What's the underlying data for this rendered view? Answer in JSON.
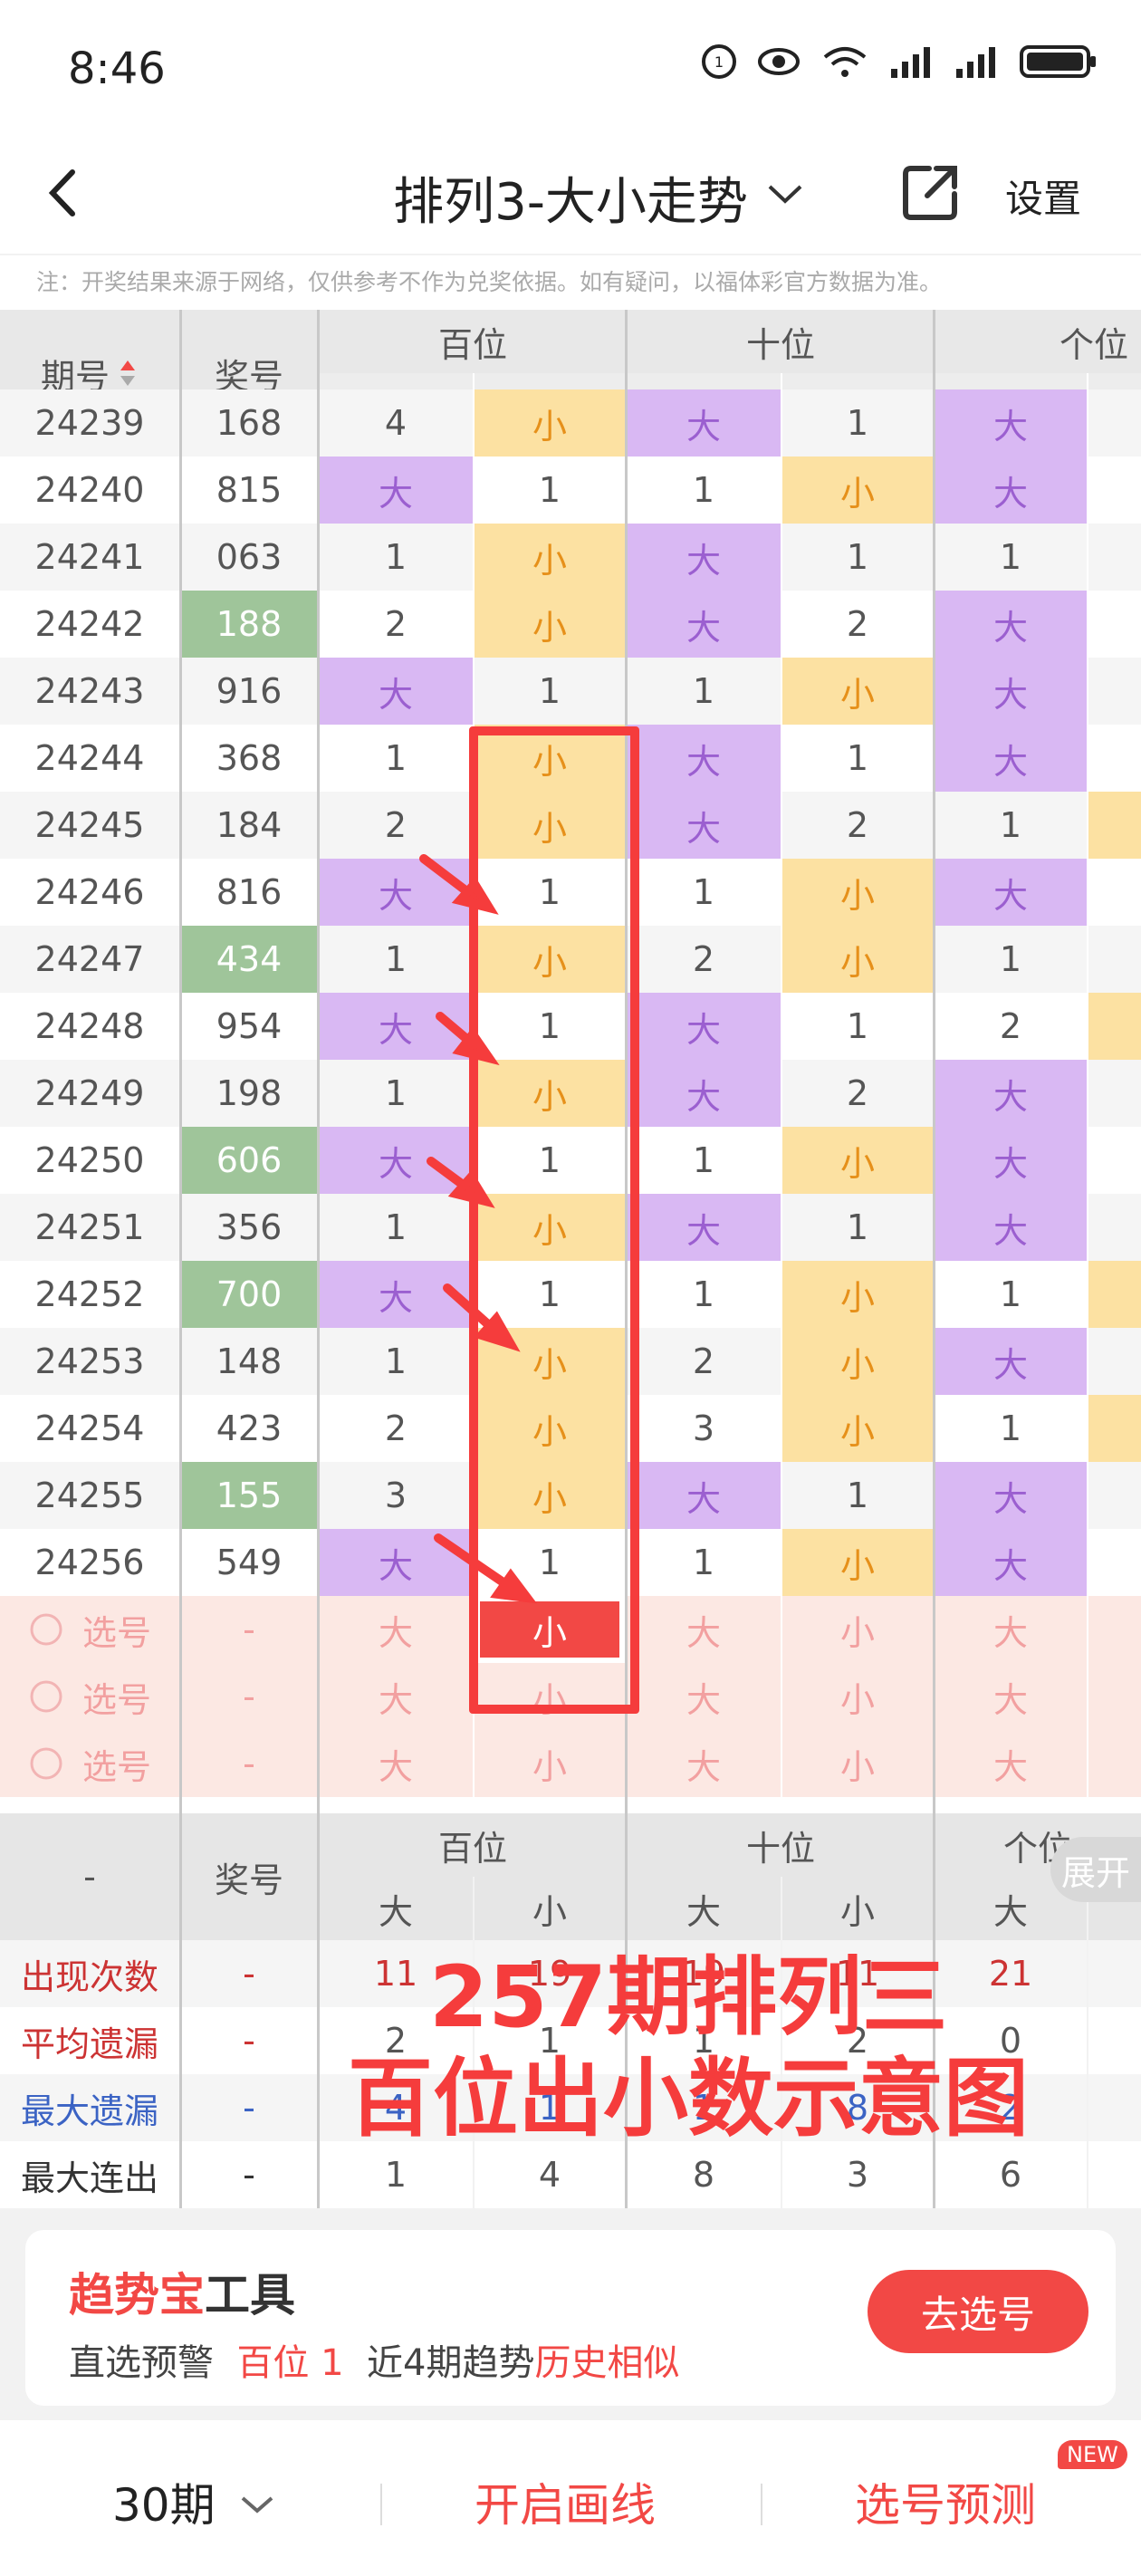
{
  "status": {
    "time": "8:46"
  },
  "header": {
    "title": "排列3-大小走势",
    "settings": "设置"
  },
  "notice": "注：开奖结果来源于网络，仅供参考不作为兑奖依据。如有疑问，以福体彩官方数据为准。",
  "table": {
    "col_issue": "期号",
    "col_number": "奖号",
    "group_hundreds": "百位",
    "group_tens": "十位",
    "group_units": "个位",
    "sub_big": "大",
    "sub_small": "小"
  },
  "rows": [
    {
      "issue": "24239",
      "num": "168",
      "hb": "4",
      "hs": "小",
      "tb": "大",
      "ts": "1",
      "ub": "大",
      "green": false
    },
    {
      "issue": "24240",
      "num": "815",
      "hb": "大",
      "hs": "1",
      "tb": "1",
      "ts": "小",
      "ub": "大",
      "green": false
    },
    {
      "issue": "24241",
      "num": "063",
      "hb": "1",
      "hs": "小",
      "tb": "大",
      "ts": "1",
      "ub": "1",
      "green": false
    },
    {
      "issue": "24242",
      "num": "188",
      "hb": "2",
      "hs": "小",
      "tb": "大",
      "ts": "2",
      "ub": "大",
      "green": true
    },
    {
      "issue": "24243",
      "num": "916",
      "hb": "大",
      "hs": "1",
      "tb": "1",
      "ts": "小",
      "ub": "大",
      "green": false
    },
    {
      "issue": "24244",
      "num": "368",
      "hb": "1",
      "hs": "小",
      "tb": "大",
      "ts": "1",
      "ub": "大",
      "green": false
    },
    {
      "issue": "24245",
      "num": "184",
      "hb": "2",
      "hs": "小",
      "tb": "大",
      "ts": "2",
      "ub": "1",
      "green": false
    },
    {
      "issue": "24246",
      "num": "816",
      "hb": "大",
      "hs": "1",
      "tb": "1",
      "ts": "小",
      "ub": "大",
      "green": false
    },
    {
      "issue": "24247",
      "num": "434",
      "hb": "1",
      "hs": "小",
      "tb": "2",
      "ts": "小",
      "ub": "1",
      "green": true
    },
    {
      "issue": "24248",
      "num": "954",
      "hb": "大",
      "hs": "1",
      "tb": "大",
      "ts": "1",
      "ub": "2",
      "green": false
    },
    {
      "issue": "24249",
      "num": "198",
      "hb": "1",
      "hs": "小",
      "tb": "大",
      "ts": "2",
      "ub": "大",
      "green": false
    },
    {
      "issue": "24250",
      "num": "606",
      "hb": "大",
      "hs": "1",
      "tb": "1",
      "ts": "小",
      "ub": "大",
      "green": true
    },
    {
      "issue": "24251",
      "num": "356",
      "hb": "1",
      "hs": "小",
      "tb": "大",
      "ts": "1",
      "ub": "大",
      "green": false
    },
    {
      "issue": "24252",
      "num": "700",
      "hb": "大",
      "hs": "1",
      "tb": "1",
      "ts": "小",
      "ub": "1",
      "green": true
    },
    {
      "issue": "24253",
      "num": "148",
      "hb": "1",
      "hs": "小",
      "tb": "2",
      "ts": "小",
      "ub": "大",
      "green": false
    },
    {
      "issue": "24254",
      "num": "423",
      "hb": "2",
      "hs": "小",
      "tb": "3",
      "ts": "小",
      "ub": "1",
      "green": false
    },
    {
      "issue": "24255",
      "num": "155",
      "hb": "3",
      "hs": "小",
      "tb": "大",
      "ts": "1",
      "ub": "大",
      "green": true
    },
    {
      "issue": "24256",
      "num": "549",
      "hb": "大",
      "hs": "1",
      "tb": "1",
      "ts": "小",
      "ub": "大",
      "green": false
    }
  ],
  "select_rows": [
    {
      "label": "选号",
      "num": "-",
      "hb": "大",
      "hs": "小",
      "tb": "大",
      "ts": "小",
      "ub": "大",
      "active_hs": true
    },
    {
      "label": "选号",
      "num": "-",
      "hb": "大",
      "hs": "小",
      "tb": "大",
      "ts": "小",
      "ub": "大",
      "active_hs": false
    },
    {
      "label": "选号",
      "num": "-",
      "hb": "大",
      "hs": "小",
      "tb": "大",
      "ts": "小",
      "ub": "大",
      "active_hs": false
    }
  ],
  "stats_header": {
    "dash": "-",
    "number": "奖号",
    "hundreds": "百位",
    "tens": "十位",
    "units": "个位",
    "big": "大",
    "small": "小",
    "expand": "展开"
  },
  "stats": [
    {
      "label": "出现次数",
      "num": "-",
      "v": [
        "11",
        "19",
        "19",
        "11",
        "21"
      ]
    },
    {
      "label": "平均遗漏",
      "num": "-",
      "v": [
        "2",
        "1",
        "1",
        "2",
        "0"
      ]
    },
    {
      "label": "最大遗漏",
      "num": "-",
      "v": [
        "4",
        "1",
        "1",
        "8",
        "2"
      ]
    },
    {
      "label": "最大连出",
      "num": "-",
      "v": [
        "1",
        "4",
        "8",
        "3",
        "6"
      ]
    }
  ],
  "overlay": {
    "line1": "257期排列三",
    "line2": "百位出小数示意图"
  },
  "tool": {
    "brand": "趋势宝",
    "brand_suffix": "工具",
    "pre": "直选预警",
    "pos": "百位 1",
    "mid": "近4期趋势",
    "hist": "历史相似",
    "button": "去选号"
  },
  "bottom": {
    "periods": "30期",
    "draw": "开启画线",
    "predict": "选号预测",
    "new_badge": "NEW"
  },
  "colors": {
    "accent_red": "#f24845",
    "big_bg": "#d9b8f3",
    "small_bg": "#fce1a2",
    "green": "#9fc59a"
  }
}
